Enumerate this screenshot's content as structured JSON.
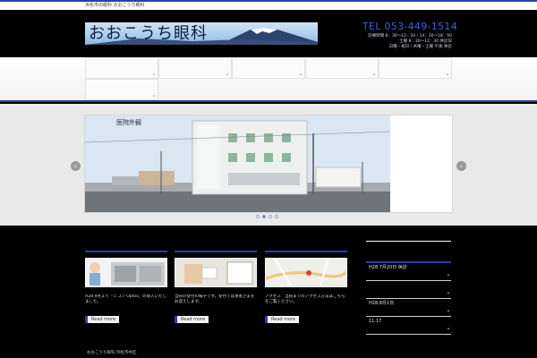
{
  "topbar": {
    "tagline": "浜松市の眼科 おおこうち眼科"
  },
  "header": {
    "logo_text": "おおこうち眼科",
    "tel": "TEL 053-449-1514",
    "hours": [
      "診療時間 8：30～12：30 / 14：30～18：00",
      "土曜 8：30～12：30 休診日",
      "日曜・祝日 / 木曜・土曜 午後 休診"
    ]
  },
  "nav": {
    "rows": 2,
    "cols": 5
  },
  "slider": {
    "caption": "医院外観",
    "prev_label": "‹",
    "next_label": "›",
    "slides": 4,
    "active": 1
  },
  "features": [
    {
      "text": "H28.9月より「ニコン Optos」の導入いたしました。",
      "more": "Read more"
    },
    {
      "text": "当院の受付の様子です。受付では患者さまをお迎えします。",
      "more": "Read more"
    },
    {
      "text": "アクセス　当院までのアクセス方法はこちらをご覧ください。",
      "more": "Read more"
    },
    {
      "text": "",
      "more": ""
    }
  ],
  "sidebar": {
    "rows": [
      "H28.7月20日 休診",
      "",
      "H28.8月1日",
      "11.17",
      ""
    ]
  },
  "footer": {
    "text": "おおこうち眼科 浜松市中区"
  },
  "colors": {
    "accent": "#2b3fa8",
    "tel": "#3a5fd9"
  }
}
